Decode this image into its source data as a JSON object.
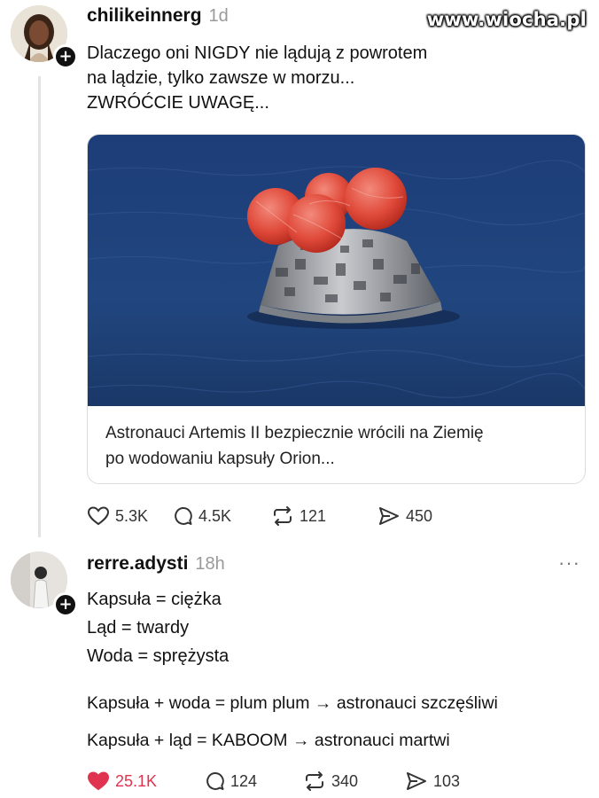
{
  "watermark": "www.wiocha.pl",
  "post1": {
    "username": "chilikeinnerg",
    "time": "1d",
    "lines": [
      "Dlaczego oni NIGDY nie lądują z powrotem",
      "na lądzie, tylko zawsze w morzu...",
      "ZWRÓĆCIE UWAGĘ..."
    ],
    "card_caption_lines": [
      "Astronauci Artemis II bezpiecznie wrócili na Ziemię",
      "po wodowaniu kapsuły Orion..."
    ],
    "likes": "5.3K",
    "comments": "4.5K",
    "reposts": "121",
    "shares": "450"
  },
  "post2": {
    "username": "rerre.adysti",
    "time": "18h",
    "more": "···",
    "lines": [
      "Kapsuła = ciężka",
      "Ląd = twardy",
      "Woda = sprężysta"
    ],
    "lines2": [
      "Kapsuła + woda = plum plum → astronauci szczęśliwi",
      "Kapsuła + ląd = KABOOM → astronauci martwi"
    ],
    "likes": "25.1K",
    "comments": "124",
    "reposts": "340",
    "shares": "103"
  },
  "colors": {
    "like_active": "#e0334f",
    "muted": "#9a9a9a",
    "sea": "#1f3f78"
  }
}
